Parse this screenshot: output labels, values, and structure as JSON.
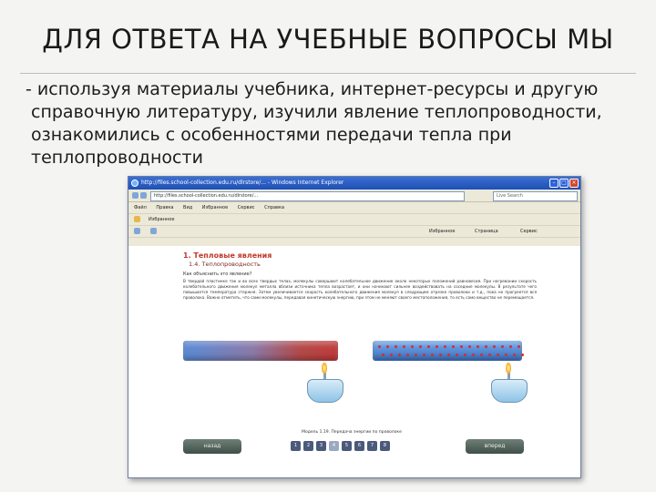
{
  "slide": {
    "title": "ДЛЯ ОТВЕТА НА УЧЕБНЫЕ ВОПРОСЫ МЫ",
    "lines": [
      "- используя материалы учебника, интернет-ресурсы и другую",
      "справочную литературу, изучили явление теплопроводности,",
      "ознакомились с особенностями передачи тепла при",
      "теплопроводности"
    ]
  },
  "browser": {
    "window_title": "http://files.school-collection.edu.ru/dlrstore/...  - Windows Internet Explorer",
    "address": "http://files.school-collection.edu.ru/dlrstore/...",
    "search_placeholder": "Live Search",
    "menu": [
      "Файл",
      "Правка",
      "Вид",
      "Избранное",
      "Сервис",
      "Справка"
    ],
    "toolbar": [
      "Избранное",
      "Страница",
      "Сервис"
    ],
    "favorites": [
      "Избранное"
    ]
  },
  "content": {
    "header": "1. Тепловые явления",
    "subheader": "1.4. Теплопроводность",
    "question": "Как объяснить это явление?",
    "paragraph": "В твердой пластинке так и во всех твердых телах, молекулы совершают колебательное движение около некоторых положений равновесия. При нагревании скорость колебательного движения молекул металла вблизи источника тепла возрастает, и они начинают сильнее воздействовать на соседние молекулы. В результате чего повышается температура стержня. Затем увеличивается скорость колебательного движения молекул в следующем отрезке проволоки и т.д., пока не прогреется вся проволока. Важно отметить, что сами молекулы, передавая кинетическую энергию, при этом не меняют своего местоположения, то есть само вещество не перемещается.",
    "model_caption": "Модель 1.19. Передача энергии по проволоке",
    "prev_label": "назад",
    "next_label": "вперед",
    "pages": [
      "1",
      "2",
      "3",
      "4",
      "5",
      "6",
      "7",
      "8"
    ],
    "active_page": 4
  }
}
